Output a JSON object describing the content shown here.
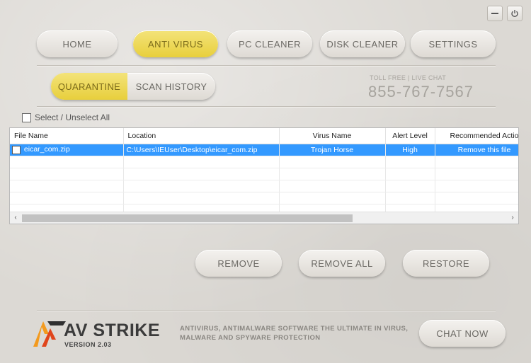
{
  "window": {
    "minimize_icon": "minimize-icon",
    "power_icon": "power-icon"
  },
  "nav": {
    "home": "HOME",
    "antivirus": "ANTI VIRUS",
    "pc_cleaner": "PC CLEANER",
    "disk_cleaner": "DISK CLEANER",
    "settings": "SETTINGS"
  },
  "subtabs": {
    "quarantine": "QUARANTINE",
    "scan_history": "SCAN HISTORY"
  },
  "contact": {
    "label": "TOLL FREE | LIVE CHAT",
    "phone": "855-767-7567"
  },
  "select_all": "Select / Unselect All",
  "grid": {
    "columns": [
      "File Name",
      "Location",
      "Virus Name",
      "Alert Level",
      "Recommended Actio"
    ],
    "rows": [
      {
        "file": "eicar_com.zip",
        "location": "C:\\Users\\IEUser\\Desktop\\eicar_com.zip",
        "virus": "Trojan Horse",
        "alert": "High",
        "action": "Remove this file"
      }
    ]
  },
  "actions": {
    "remove": "REMOVE",
    "remove_all": "REMOVE ALL",
    "restore": "RESTORE"
  },
  "footer": {
    "brand_av": "AV",
    "brand_strike": "STRIKE",
    "version": "VERSION 2.03",
    "tagline": "ANTIVIRUS, ANTIMALWARE SOFTWARE THE ULTIMATE IN VIRUS, MALWARE AND SPYWARE PROTECTION",
    "chat": "CHAT NOW"
  },
  "colors": {
    "accent": "#e8cf3c",
    "selection": "#3399ff",
    "logo_orange": "#f39a1e"
  }
}
